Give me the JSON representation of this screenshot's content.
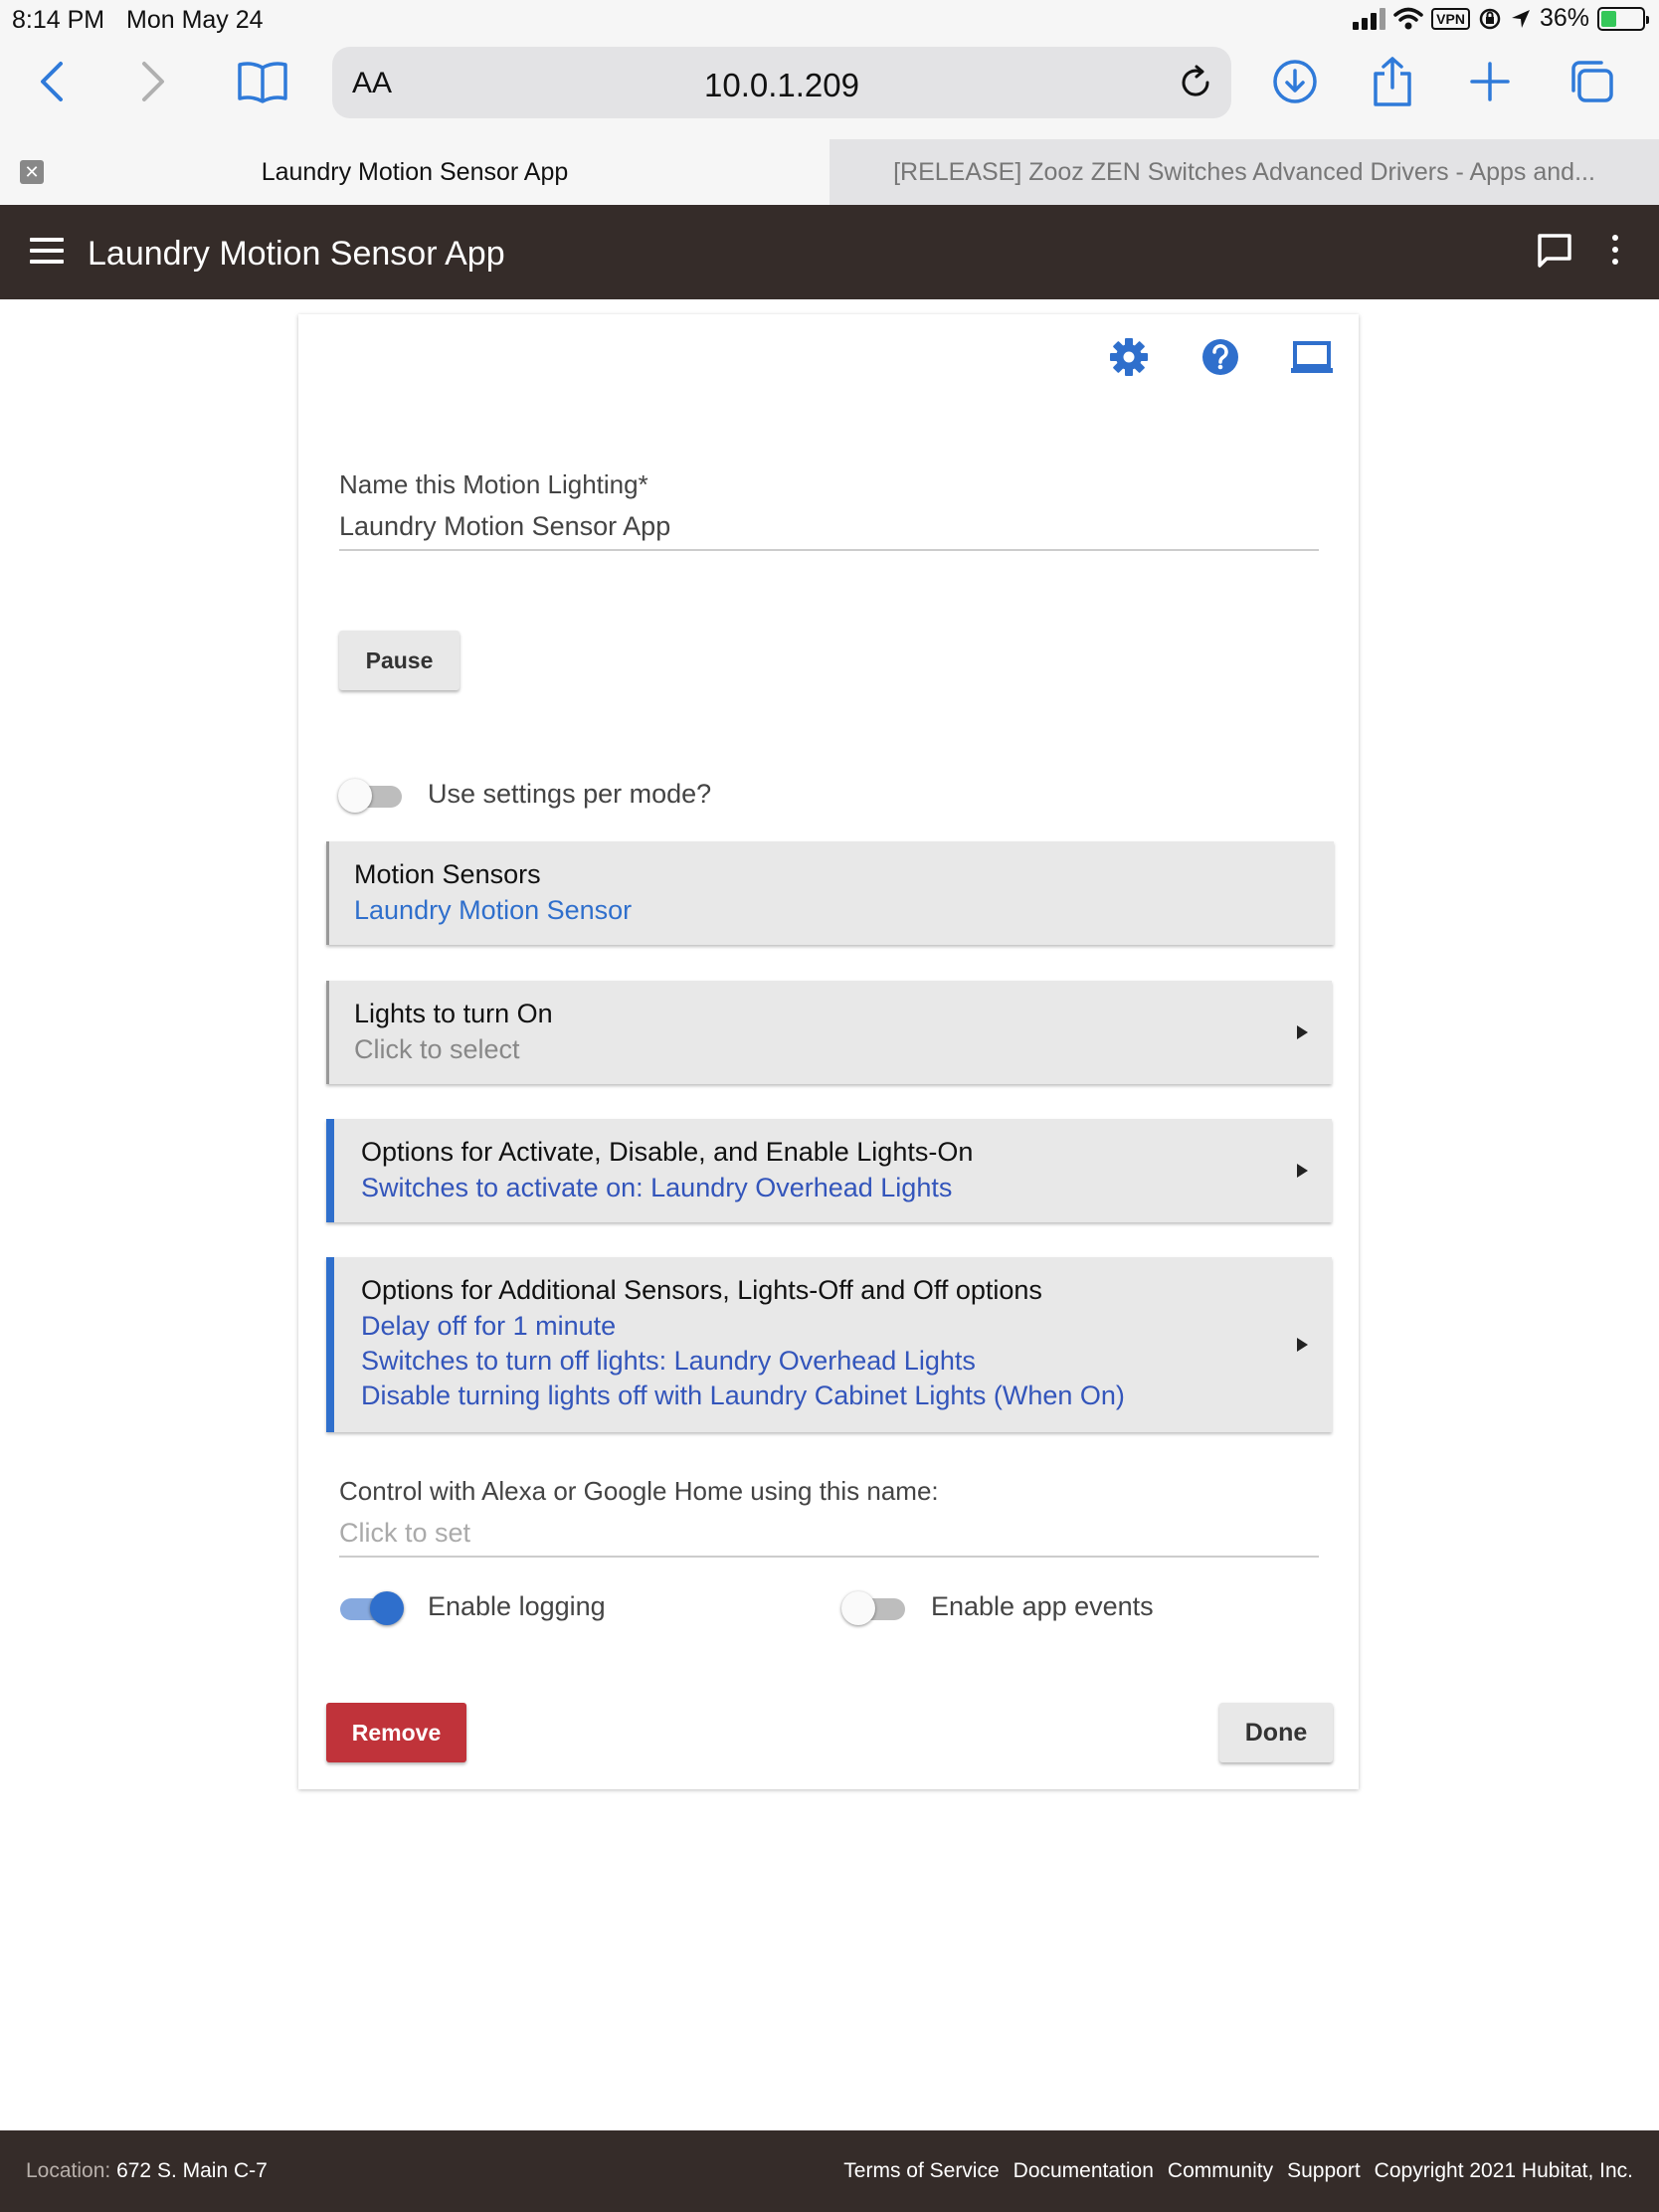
{
  "status_bar": {
    "time": "8:14 PM",
    "date": "Mon May 24",
    "vpn": "VPN",
    "battery": "36%"
  },
  "browser": {
    "text_size_button": "AA",
    "url": "10.0.1.209",
    "tabs": [
      {
        "label": "Laundry Motion Sensor App",
        "active": true
      },
      {
        "label": "[RELEASE] Zooz ZEN Switches Advanced Drivers - Apps and...",
        "active": false
      }
    ]
  },
  "app_header": {
    "title": "Laundry Motion Sensor App"
  },
  "form": {
    "name_field": {
      "label": "Name this Motion Lighting*",
      "value": "Laundry Motion Sensor App"
    },
    "pause_label": "Pause",
    "settings_per_mode": {
      "label": "Use settings per mode?",
      "on": false
    },
    "sections": [
      {
        "title": "Motion Sensors",
        "lines": [
          "Laundry Motion Sensor"
        ]
      },
      {
        "title": "Lights to turn On",
        "lines": [
          "Click to select"
        ]
      },
      {
        "title": "Options for Activate, Disable, and Enable Lights-On",
        "lines": [
          "Switches to activate on: Laundry Overhead Lights"
        ]
      },
      {
        "title": "Options for Additional Sensors, Lights-Off and Off options",
        "lines": [
          "Delay off for 1 minute",
          "Switches to turn off lights: Laundry Overhead Lights",
          "Disable turning lights off with Laundry Cabinet Lights (When On)"
        ]
      }
    ],
    "alexa_field": {
      "label": "Control with Alexa or Google Home using this name:",
      "placeholder": "Click to set"
    },
    "enable_logging": {
      "label": "Enable logging",
      "on": true
    },
    "enable_app_events": {
      "label": "Enable app events",
      "on": false
    },
    "remove_label": "Remove",
    "done_label": "Done"
  },
  "footer": {
    "location_key": "Location:",
    "location_value": "672 S. Main C-7",
    "links": [
      "Terms of Service",
      "Documentation",
      "Community",
      "Support",
      "Copyright 2021 Hubitat, Inc."
    ]
  },
  "colors": {
    "header_bg": "#352c29",
    "accent_blue": "#2f6fcc",
    "remove_red": "#c0333a",
    "section_bg": "#e8e8e8"
  }
}
